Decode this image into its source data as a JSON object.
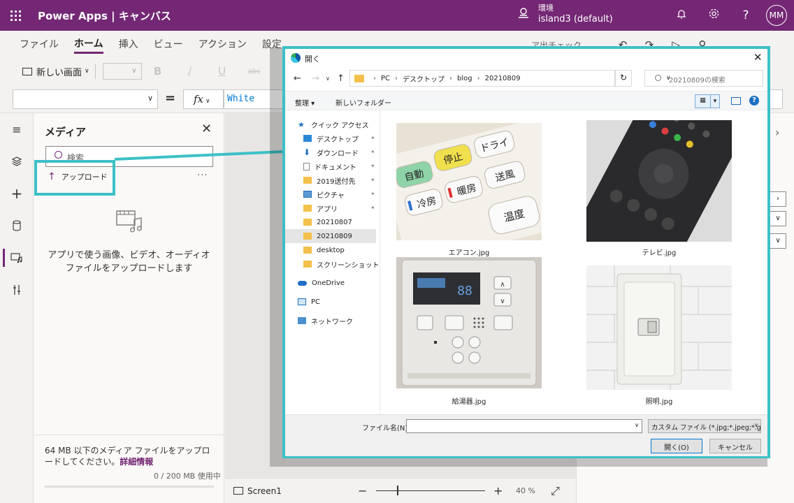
{
  "topbar": {
    "app_title": "Power Apps | キャンバス",
    "env_label": "環境",
    "env_name": "island3 (default)",
    "avatar": "MM"
  },
  "menu": {
    "items": [
      {
        "label": "ファイル",
        "active": false
      },
      {
        "label": "ホーム",
        "active": true
      },
      {
        "label": "挿入",
        "active": false
      },
      {
        "label": "ビュー",
        "active": false
      },
      {
        "label": "アクション",
        "active": false
      },
      {
        "label": "設定",
        "active": false
      }
    ],
    "right_text": "ア出チェック"
  },
  "toolbar": {
    "new_screen": "新しい画面",
    "bold": "B",
    "italic": "/",
    "underline": "U",
    "strike": "abc"
  },
  "formula": {
    "equals": "=",
    "fx": "fx",
    "value": "White"
  },
  "media": {
    "title": "メディア",
    "search_placeholder": "検索",
    "upload": "アップロード",
    "more": "···",
    "empty_text": "アプリで使う画像、ビデオ、オーディオ ファイルをアップロードします",
    "footer_text": "64 MB 以下のメディア ファイルをアップロードしてください。",
    "footer_link": "詳細情報",
    "usage": "0 / 200 MB 使用中"
  },
  "bottombar": {
    "screen": "Screen1",
    "zoom": "40 %"
  },
  "dialog": {
    "title": "開く",
    "breadcrumb": [
      "PC",
      "デスクトップ",
      "blog",
      "20210809"
    ],
    "search_placeholder": "20210809の検索",
    "organize": "整理 ▾",
    "new_folder": "新しいフォルダー",
    "tree": [
      {
        "label": "クイック アクセス",
        "icon": "star-icon",
        "pinned": false
      },
      {
        "label": "デスクトップ",
        "icon": "desktop-icon",
        "pinned": true
      },
      {
        "label": "ダウンロード",
        "icon": "download-icon",
        "pinned": true
      },
      {
        "label": "ドキュメント",
        "icon": "document-icon",
        "pinned": true
      },
      {
        "label": "2019送付先",
        "icon": "folder-icon",
        "pinned": true
      },
      {
        "label": "ピクチャ",
        "icon": "pictures-icon",
        "pinned": true
      },
      {
        "label": "アプリ",
        "icon": "folder-icon",
        "pinned": true
      },
      {
        "label": "20210807",
        "icon": "folder-icon",
        "pinned": false
      },
      {
        "label": "20210809",
        "icon": "folder-icon",
        "pinned": false
      },
      {
        "label": "desktop",
        "icon": "folder-icon",
        "pinned": false
      },
      {
        "label": "スクリーンショット",
        "icon": "folder-icon",
        "pinned": false
      },
      {
        "label": "OneDrive",
        "icon": "cloud-icon",
        "pinned": false
      },
      {
        "label": "PC",
        "icon": "pc-icon",
        "pinned": false
      },
      {
        "label": "ネットワーク",
        "icon": "network-icon",
        "pinned": false
      }
    ],
    "files": [
      {
        "name": "エアコン.jpg"
      },
      {
        "name": "テレビ.jpg"
      },
      {
        "name": "給湯器.jpg"
      },
      {
        "name": "照明.jpg"
      }
    ],
    "filename_label": "ファイル名(N):",
    "filetype": "カスタム ファイル (*.jpg;*.jpeg;*.gif",
    "open_button": "開く(O)",
    "cancel_button": "キャンセル",
    "remote_labels": {
      "kadou": "自動",
      "teishi": "停止",
      "dry": "ドライ",
      "reibou": "冷房",
      "danbou": "暖房",
      "soufuu": "送風",
      "ondo": "温度"
    }
  }
}
